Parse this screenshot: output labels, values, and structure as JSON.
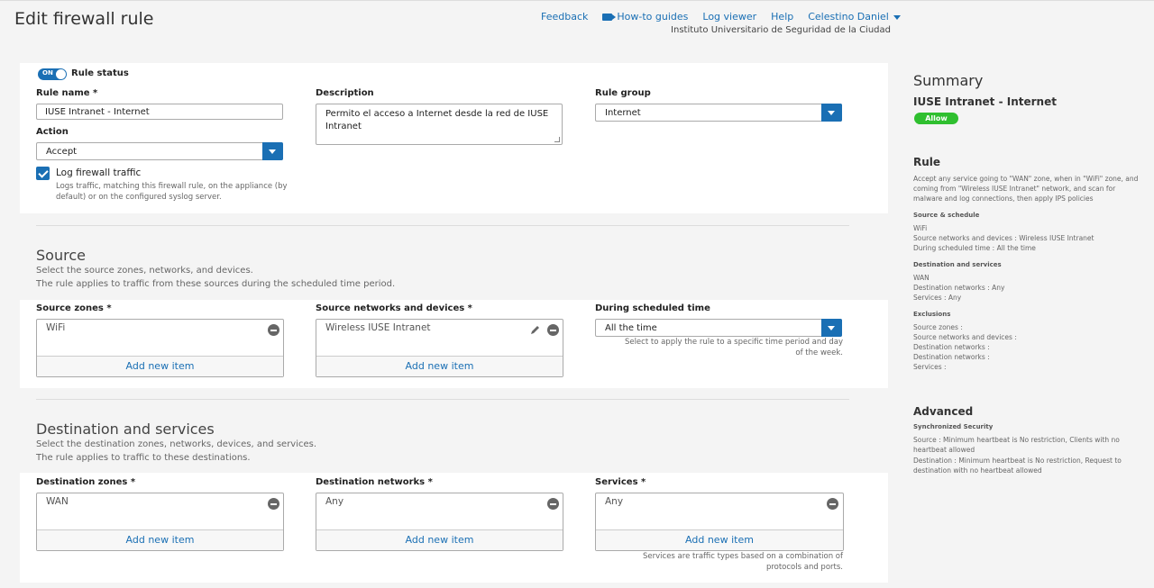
{
  "page": {
    "title": "Edit firewall rule"
  },
  "topnav": {
    "feedback": "Feedback",
    "howto": "How-to guides",
    "logviewer": "Log viewer",
    "help": "Help",
    "user": "Celestino Daniel",
    "org": "Instituto Universitario de Seguridad de la Ciudad"
  },
  "rule": {
    "status_label": "Rule status",
    "toggle_text": "ON",
    "name_label": "Rule name *",
    "name_value": "IUSE Intranet - Internet",
    "description_label": "Description",
    "description_value": "Permito el acceso a Internet desde la red de IUSE Intranet",
    "group_label": "Rule group",
    "group_value": "Internet",
    "action_label": "Action",
    "action_value": "Accept",
    "log_label": "Log firewall traffic",
    "log_help": "Logs traffic, matching this firewall rule, on the appliance (by default) or on the configured syslog server."
  },
  "source": {
    "title": "Source",
    "desc1": "Select the source zones, networks, and devices.",
    "desc2": "The rule applies to traffic from these sources during the scheduled time period.",
    "zones_label": "Source zones *",
    "zones_item": "WiFi",
    "networks_label": "Source networks and devices *",
    "networks_item": "Wireless IUSE Intranet",
    "schedule_label": "During scheduled time",
    "schedule_value": "All the time",
    "schedule_help": "Select to apply the rule to a specific time period and day of the week.",
    "add_new": "Add new item"
  },
  "destination": {
    "title": "Destination and services",
    "desc1": "Select the destination zones, networks, devices, and services.",
    "desc2": "The rule applies to traffic to these destinations.",
    "zones_label": "Destination zones *",
    "zones_item": "WAN",
    "networks_label": "Destination networks *",
    "networks_item": "Any",
    "services_label": "Services *",
    "services_item": "Any",
    "services_help": "Services are traffic types based on a combination of protocols and ports.",
    "add_new": "Add new item"
  },
  "summary": {
    "title": "Summary",
    "rule_name": "IUSE Intranet - Internet",
    "badge": "Allow",
    "rule_heading": "Rule",
    "rule_text": "Accept any service going to \"WAN\" zone, when in \"WiFi\" zone, and coming from \"Wireless IUSE Intranet\" network, and scan for malware and log connections, then apply IPS policies",
    "source_schedule": "Source & schedule",
    "ss_1": "WiFi",
    "ss_2": "Source networks and devices : Wireless IUSE Intranet",
    "ss_3": "During scheduled time : All the time",
    "dest_services": "Destination and services",
    "ds_1": "WAN",
    "ds_2": "Destination networks : Any",
    "ds_3": "Services : Any",
    "exclusions": "Exclusions",
    "ex_1": "Source zones :",
    "ex_2": "Source networks and devices :",
    "ex_3": "Destination networks :",
    "ex_4": "Destination networks :",
    "ex_5": "Services :",
    "advanced": "Advanced",
    "sync_security": "Synchronized Security",
    "adv_1": "Source : Minimum heartbeat is No restriction, Clients with no heartbeat allowed",
    "adv_2": "Destination : Minimum heartbeat is No restriction, Request to destination with no heartbeat allowed"
  },
  "colors": {
    "accent": "#1a6fb4",
    "allow_badge": "#2fbf2f"
  }
}
